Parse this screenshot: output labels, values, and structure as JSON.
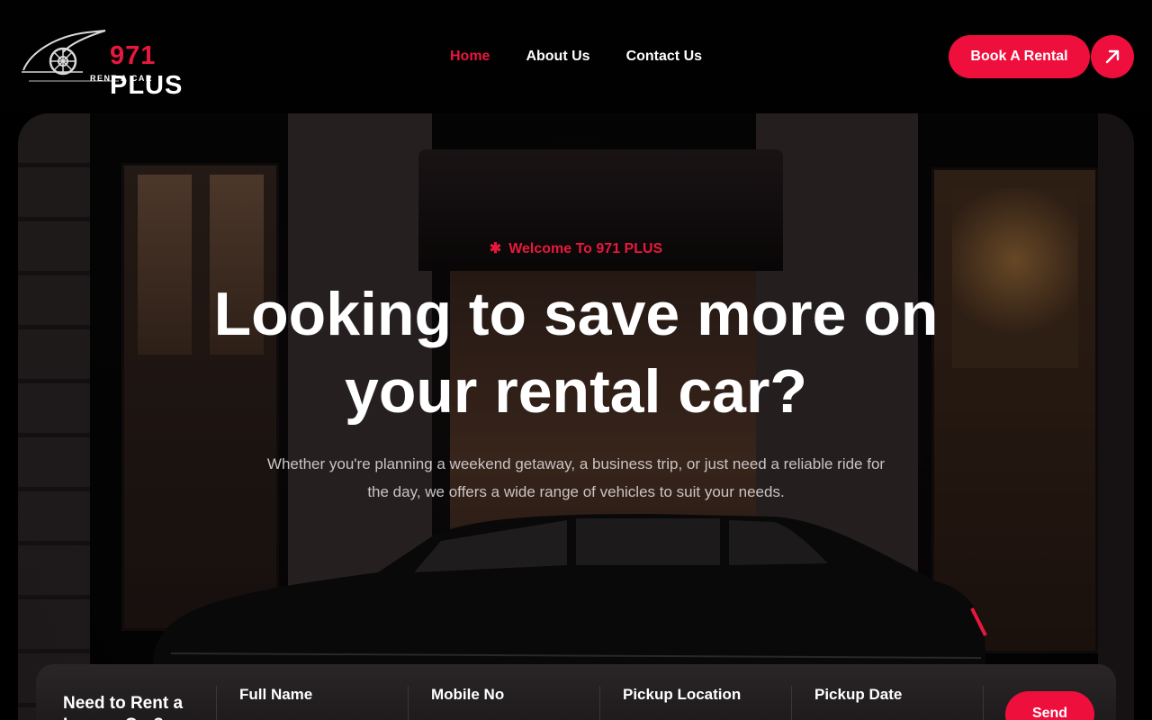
{
  "brand": {
    "number": "971",
    "name": "PLUS",
    "tagline": "RENT A CAR"
  },
  "nav": {
    "items": [
      {
        "label": "Home",
        "active": true
      },
      {
        "label": "About Us",
        "active": false
      },
      {
        "label": "Contact Us",
        "active": false
      }
    ]
  },
  "header": {
    "cta_label": "Book A Rental",
    "cta_icon": "arrow-up-right-icon"
  },
  "hero": {
    "tag_icon": "asterisk-icon",
    "tag": "Welcome To 971 PLUS",
    "headline_line1": "Looking to save more on",
    "headline_line2": "your rental car?",
    "subtext_line1": "Whether you're planning a weekend getaway, a business trip, or just need a reliable ride for",
    "subtext_line2": "the day, we offers a wide range of vehicles to suit your needs."
  },
  "form": {
    "title": "Need to Rent a Luxury Car?",
    "fields": [
      {
        "label": "Full Name"
      },
      {
        "label": "Mobile No"
      },
      {
        "label": "Pickup Location"
      },
      {
        "label": "Pickup Date"
      }
    ],
    "submit_label": "Send"
  },
  "colors": {
    "accent": "#ef0f3d",
    "background": "#020102"
  }
}
